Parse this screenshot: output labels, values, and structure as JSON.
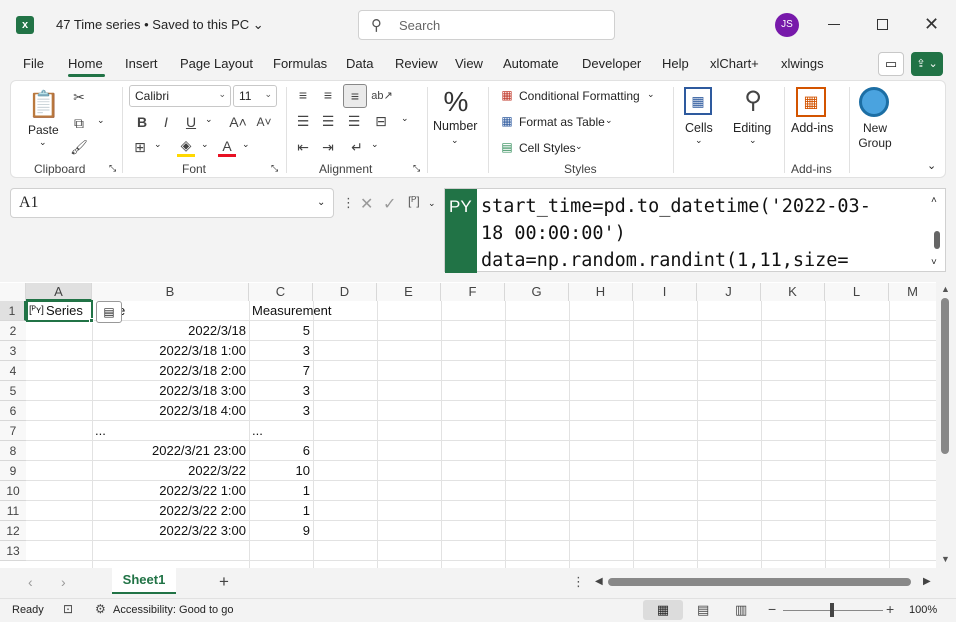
{
  "titlebar": {
    "title": "47 Time series • Saved to this PC",
    "search_placeholder": "Search",
    "user_initials": "JS",
    "colors": {
      "excel_green": "#217346",
      "avatar": "#7719aa"
    }
  },
  "menu": {
    "tabs": [
      "File",
      "Home",
      "Insert",
      "Page Layout",
      "Formulas",
      "Data",
      "Review",
      "View",
      "Automate",
      "Developer",
      "Help",
      "xlChart+",
      "xlwings"
    ],
    "active": "Home"
  },
  "ribbon": {
    "clipboard": {
      "label": "Clipboard",
      "paste": "Paste"
    },
    "font": {
      "label": "Font",
      "name": "Calibri",
      "size": "11"
    },
    "alignment": {
      "label": "Alignment"
    },
    "number": {
      "label": "Number"
    },
    "styles": {
      "label": "Styles",
      "conditional_formatting": "Conditional Formatting",
      "format_as_table": "Format as Table",
      "cell_styles": "Cell Styles"
    },
    "cells": {
      "label": "Cells"
    },
    "editing": {
      "label": "Editing"
    },
    "addins": {
      "label": "Add-ins",
      "button": "Add-ins"
    },
    "new_group": {
      "label": "New Group"
    }
  },
  "formula_bar": {
    "name_box": "A1",
    "py_badge": "PY",
    "code_line1": "start_time=pd.to_datetime('2022-03-",
    "code_line2": "18 00:00:00')",
    "code_line3": "data=np.random.randint(1,11,size="
  },
  "grid": {
    "columns": [
      "A",
      "B",
      "C",
      "D",
      "E",
      "F",
      "G",
      "H",
      "I",
      "J",
      "K",
      "L",
      "M"
    ],
    "rows": [
      "1",
      "2",
      "3",
      "4",
      "5",
      "6",
      "7",
      "8",
      "9",
      "10",
      "11",
      "12",
      "13"
    ],
    "a1": "Series",
    "b1_partial": "e",
    "c1": "Measurement",
    "col_b": [
      "2022/3/18",
      "2022/3/18 1:00",
      "2022/3/18 2:00",
      "2022/3/18 3:00",
      "2022/3/18 4:00",
      "...",
      "2022/3/21 23:00",
      "2022/3/22",
      "2022/3/22 1:00",
      "2022/3/22 2:00",
      "2022/3/22 3:00"
    ],
    "col_c": [
      "5",
      "3",
      "7",
      "3",
      "3",
      "...",
      "6",
      "10",
      "1",
      "1",
      "9"
    ]
  },
  "sheets": {
    "active": "Sheet1"
  },
  "status": {
    "ready": "Ready",
    "accessibility": "Accessibility: Good to go",
    "zoom": "100%"
  }
}
